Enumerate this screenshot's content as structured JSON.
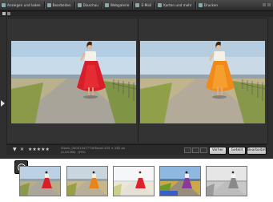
{
  "menubar": {
    "items": [
      {
        "label": "Anzeigen und laden",
        "icon": "folder-icon"
      },
      {
        "label": "Bearbeiten",
        "icon": "edit-icon"
      },
      {
        "label": "Diaschau",
        "icon": "slideshow-icon"
      },
      {
        "label": "Webgalerie",
        "icon": "web-gallery-icon"
      },
      {
        "label": "E-Mail",
        "icon": "email-icon"
      },
      {
        "label": "Karten und mehr",
        "icon": "cards-icon"
      },
      {
        "label": "Drucken",
        "icon": "print-icon"
      }
    ]
  },
  "bottombar": {
    "rating_stars": "★★★★★",
    "file_line1": "iStock_000014477740Small",
    "file_size": "425 × 282 px",
    "file_line2": "(0,04 MB) · JPEG"
  },
  "buttons": {
    "before": "Vorher",
    "after": "Geteilt",
    "edit": "Bearbeitet"
  },
  "colors": {
    "accent": "#dadada",
    "panel": "#2f2f2f",
    "dress_before": "#e0202a",
    "dress_after": "#f08a1a"
  },
  "thumbnails": [
    {
      "effect": "natural",
      "dress": "#d81e2a"
    },
    {
      "effect": "warm",
      "dress": "#e8851a"
    },
    {
      "effect": "high-key",
      "dress": "#e0202a"
    },
    {
      "effect": "vivid",
      "dress": "#8a3a9a"
    },
    {
      "effect": "black-and-white",
      "dress": "#8a8a8a"
    }
  ]
}
